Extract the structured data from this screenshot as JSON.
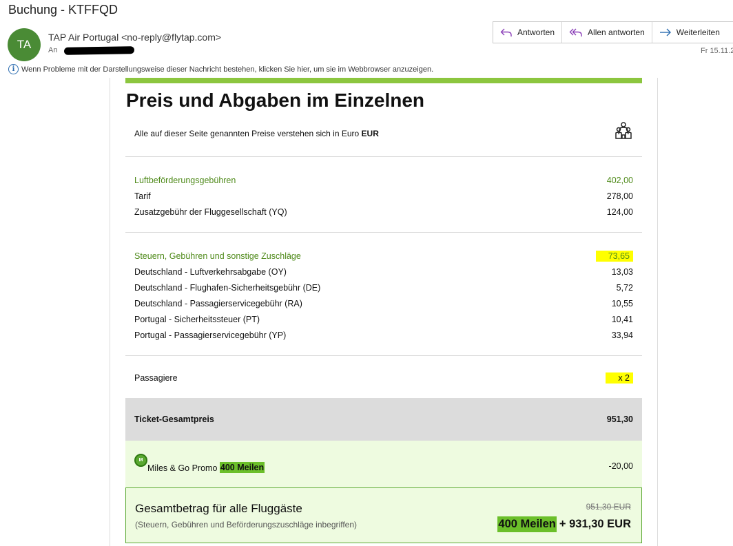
{
  "window": {
    "subject": "Buchung - KTFFQD"
  },
  "sender": {
    "initials": "TA",
    "name": "TAP Air Portugal <no-reply@flytap.com>",
    "to_label": "An",
    "date": "Fr 15.11.2"
  },
  "actions": {
    "reply": "Antworten",
    "reply_all": "Allen antworten",
    "forward": "Weiterleiten"
  },
  "infobar": {
    "text": "Wenn Probleme mit der Darstellungsweise dieser Nachricht bestehen, klicken Sie hier, um sie im Webbrowser anzuzeigen."
  },
  "colors": {
    "accent_green": "#8cc63f",
    "section_green": "#4f8a1a",
    "highlight_yellow": "#ffff00",
    "miles_green": "#6bbf2a"
  },
  "price": {
    "title": "Preis und Abgaben im Einzelnen",
    "currency_note_prefix": "Alle auf dieser Seite genannten Preise verstehen sich in Euro",
    "currency": "EUR",
    "family_icon": "family-icon",
    "air": {
      "label": "Luftbeförderungsgebühren",
      "value": "402,00",
      "rows": [
        {
          "label": "Tarif",
          "value": "278,00"
        },
        {
          "label": "Zusatzgebühr der Fluggesellschaft (YQ)",
          "value": "124,00"
        }
      ]
    },
    "taxes": {
      "label": "Steuern, Gebühren und sonstige Zuschläge",
      "value": "73,65",
      "rows": [
        {
          "label": "Deutschland - Luftverkehrsabgabe (OY)",
          "value": "13,03"
        },
        {
          "label": "Deutschland - Flughafen-Sicherheitsgebühr (DE)",
          "value": "5,72"
        },
        {
          "label": "Deutschland - Passagierservicegebühr (RA)",
          "value": "10,55"
        },
        {
          "label": "Portugal - Sicherheitssteuer (PT)",
          "value": "10,41"
        },
        {
          "label": "Portugal - Passagierservicegebühr (YP)",
          "value": "33,94"
        }
      ]
    },
    "passengers": {
      "label": "Passagiere",
      "value": "x 2"
    },
    "ticket_total": {
      "label": "Ticket-Gesamtpreis",
      "value": "951,30"
    },
    "promo": {
      "logo": "M",
      "label": "Miles & Go Promo",
      "miles": "400 Meilen",
      "value": "-20,00"
    },
    "grand": {
      "title": "Gesamtbetrag für alle Fluggäste",
      "subtitle": "(Steuern, Gebühren und Beförderungszuschläge inbegriffen)",
      "old_price": "951,30 EUR",
      "miles": "400 Meilen",
      "amount": "+ 931,30 EUR"
    }
  }
}
